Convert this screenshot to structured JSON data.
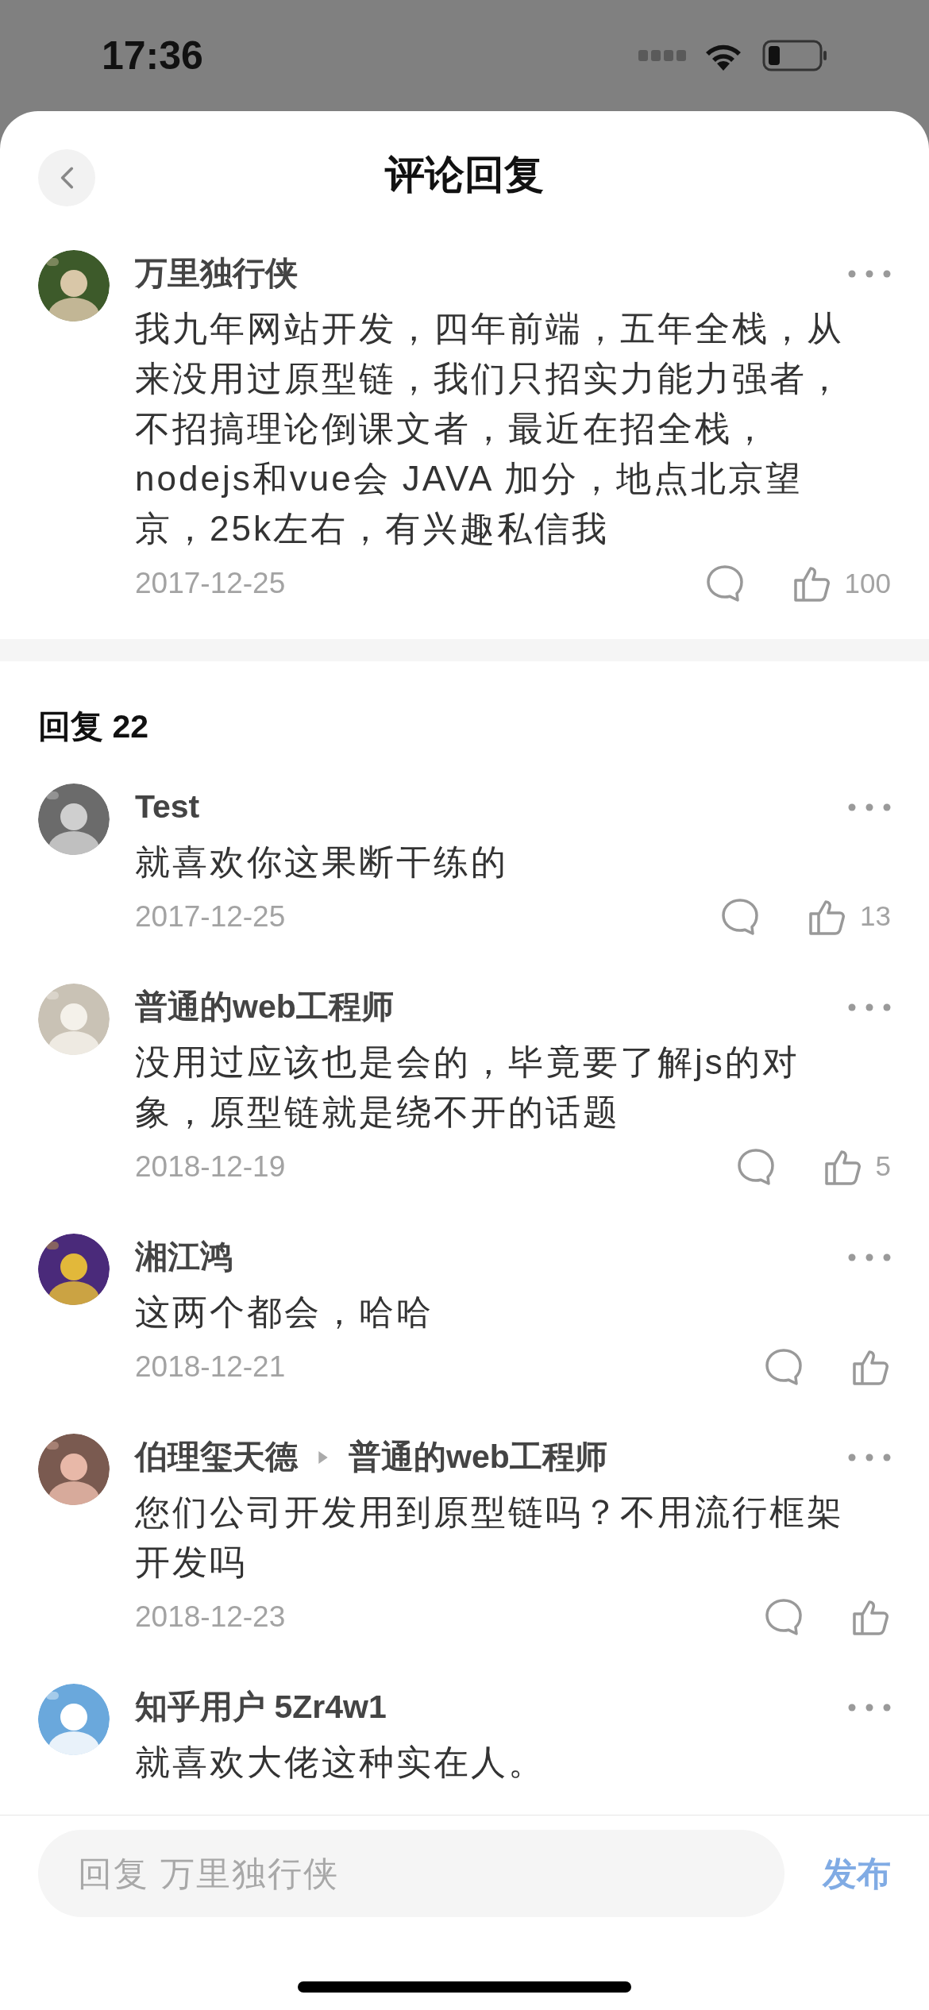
{
  "status_bar": {
    "time": "17:36"
  },
  "header": {
    "title": "评论回复"
  },
  "comment": {
    "author": "万里独行侠",
    "text": "我九年网站开发，四年前端，五年全栈，从来没用过原型链，我们只招实力能力强者，不招搞理论倒课文者，最近在招全栈，nodejs和vue会 JAVA 加分，地点北京望京，25k左右，有兴趣私信我",
    "date": "2017-12-25",
    "likes": "100"
  },
  "replies_header": {
    "label": "回复 22"
  },
  "replies": [
    {
      "author": "Test",
      "text": "就喜欢你这果断干练的",
      "date": "2017-12-25",
      "likes": "13"
    },
    {
      "author": "普通的web工程师",
      "text": "没用过应该也是会的，毕竟要了解js的对象，原型链就是绕不开的话题",
      "date": "2018-12-19",
      "likes": "5"
    },
    {
      "author": "湘江鸿",
      "text": "这两个都会，哈哈",
      "date": "2018-12-21"
    },
    {
      "author": "伯理玺天德",
      "reply_to": "普通的web工程师",
      "text": "您们公司开发用到原型链吗？不用流行框架开发吗",
      "date": "2018-12-23"
    },
    {
      "author": "知乎用户 5Zr4w1",
      "text": "就喜欢大佬这种实在人。"
    }
  ],
  "reply_bar": {
    "placeholder": "回复 万里独行侠",
    "send": "发布"
  }
}
